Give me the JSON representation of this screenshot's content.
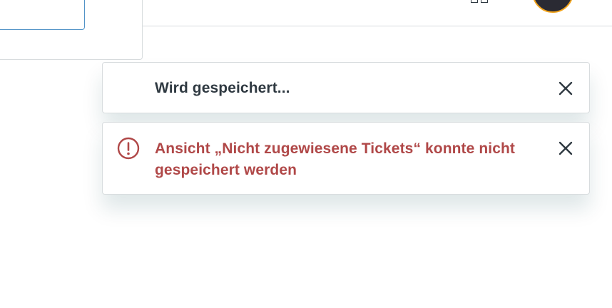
{
  "header": {
    "apps_icon": "apps-grid-icon",
    "avatar": "user-avatar"
  },
  "notifications": [
    {
      "type": "info",
      "message": "Wird gespeichert...",
      "icon": "close-icon"
    },
    {
      "type": "error",
      "message": "Ansicht „Nicht zugewiesene Tickets“ konnte nicht gespeichert werden",
      "icon": "alert-circle-icon",
      "close_icon": "close-icon"
    }
  ],
  "colors": {
    "error_text": "#b04848",
    "body_text": "#2f3941",
    "border": "#d8dcde",
    "avatar_ring": "#f0a21b",
    "input_focus": "#5293c7"
  }
}
